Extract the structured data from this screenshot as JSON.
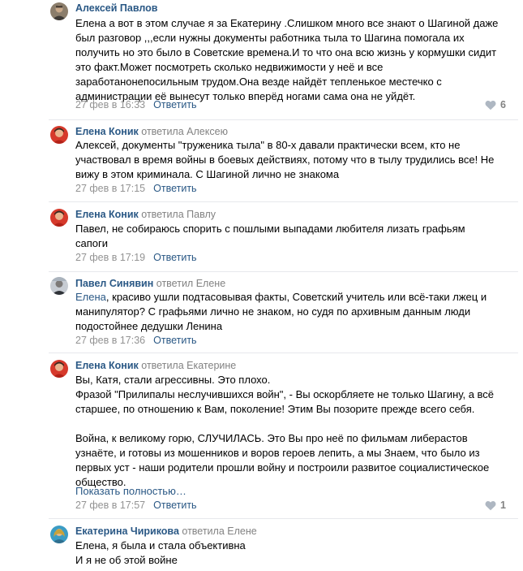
{
  "colors": {
    "link": "#2a5885",
    "muted": "#828282",
    "divider": "#e7e8ec"
  },
  "comments": [
    {
      "author": "Алексей Павлов",
      "reply_prefix": "",
      "reply_to": "",
      "text_lines": [
        "Елена а вот в этом случае я за Екатерину .Слишком много все знают о Шагиной даже",
        "был разговор ,,,если нужны документы работника тыла то Шагина помогала их",
        "получить но это было в Советские времена.И то что она всю жизнь у кормушки сидит",
        "это факт.Может посмотреть сколько недвижимости у неё и все",
        "заработанонепосильным трудом.Она везде найдёт тепленькое местечко с",
        "администрации её вынесут только вперёд ногами сама она не уйдёт."
      ],
      "date": "27 фев в 16:33",
      "reply_label": "Ответить",
      "likes": "6",
      "like_icon": "heart-icon"
    },
    {
      "author": "Елена Коник",
      "reply_prefix": "ответила",
      "reply_to": "Алексею",
      "text_lines": [
        "Алексей, документы \"труженика тыла\" в 80-х давали практически всем, кто не",
        "участвовал в время войны в боевых действиях, потому что в тылу трудились все! Не",
        "вижу в этом криминала. С Шагиной лично не знакома"
      ],
      "date": "27 фев в 17:15",
      "reply_label": "Ответить"
    },
    {
      "author": "Елена Коник",
      "reply_prefix": "ответила",
      "reply_to": "Павлу",
      "text_lines": [
        "Павел, не собираюсь спорить с пошлыми выпадами любителя лизать графьям",
        "сапоги"
      ],
      "date": "27 фев в 17:19",
      "reply_label": "Ответить"
    },
    {
      "author": "Павел Синявин",
      "reply_prefix": "ответил",
      "reply_to": "Елене",
      "mention": "Елена",
      "text_first_rest": ", красиво ушли подтасовывая факты, Советский учитель или всё-таки лжец и",
      "text_lines": [
        "манипулятор? С графьями лично не знаком, но судя по архивным данным люди",
        "подостойнее дедушки Ленина"
      ],
      "date": "27 фев в 17:36",
      "reply_label": "Ответить"
    },
    {
      "author": "Елена Коник",
      "reply_prefix": "ответила",
      "reply_to": "Екатерине",
      "text_lines": [
        "Вы, Катя, стали агрессивны. Это плохо.",
        "Фразой \"Прилипалы неслучившихся войн\", - Вы оскорбляете не только Шагину, а всё",
        "старшее, по отношению к Вам, поколение! Этим Вы позорите прежде всего себя.",
        "",
        "Война, к великому горю, СЛУЧИЛАСЬ. Это Вы про неё по фильмам либерастов",
        "узнаёте, и готовы из мошенников и воров героев лепить, а мы Знаем, что было из",
        "первых уст - наши родители прошли войну и построили развитое социалистическое",
        "общество."
      ],
      "show_more": "Показать полностью…",
      "date": "27 фев в 17:57",
      "reply_label": "Ответить",
      "likes": "1",
      "like_icon": "heart-icon"
    },
    {
      "author": "Екатерина Чирикова",
      "reply_prefix": "ответила",
      "reply_to": "Елене",
      "text_lines": [
        "Елена, я была и стала объективна",
        "И я не об этой войне"
      ]
    }
  ]
}
